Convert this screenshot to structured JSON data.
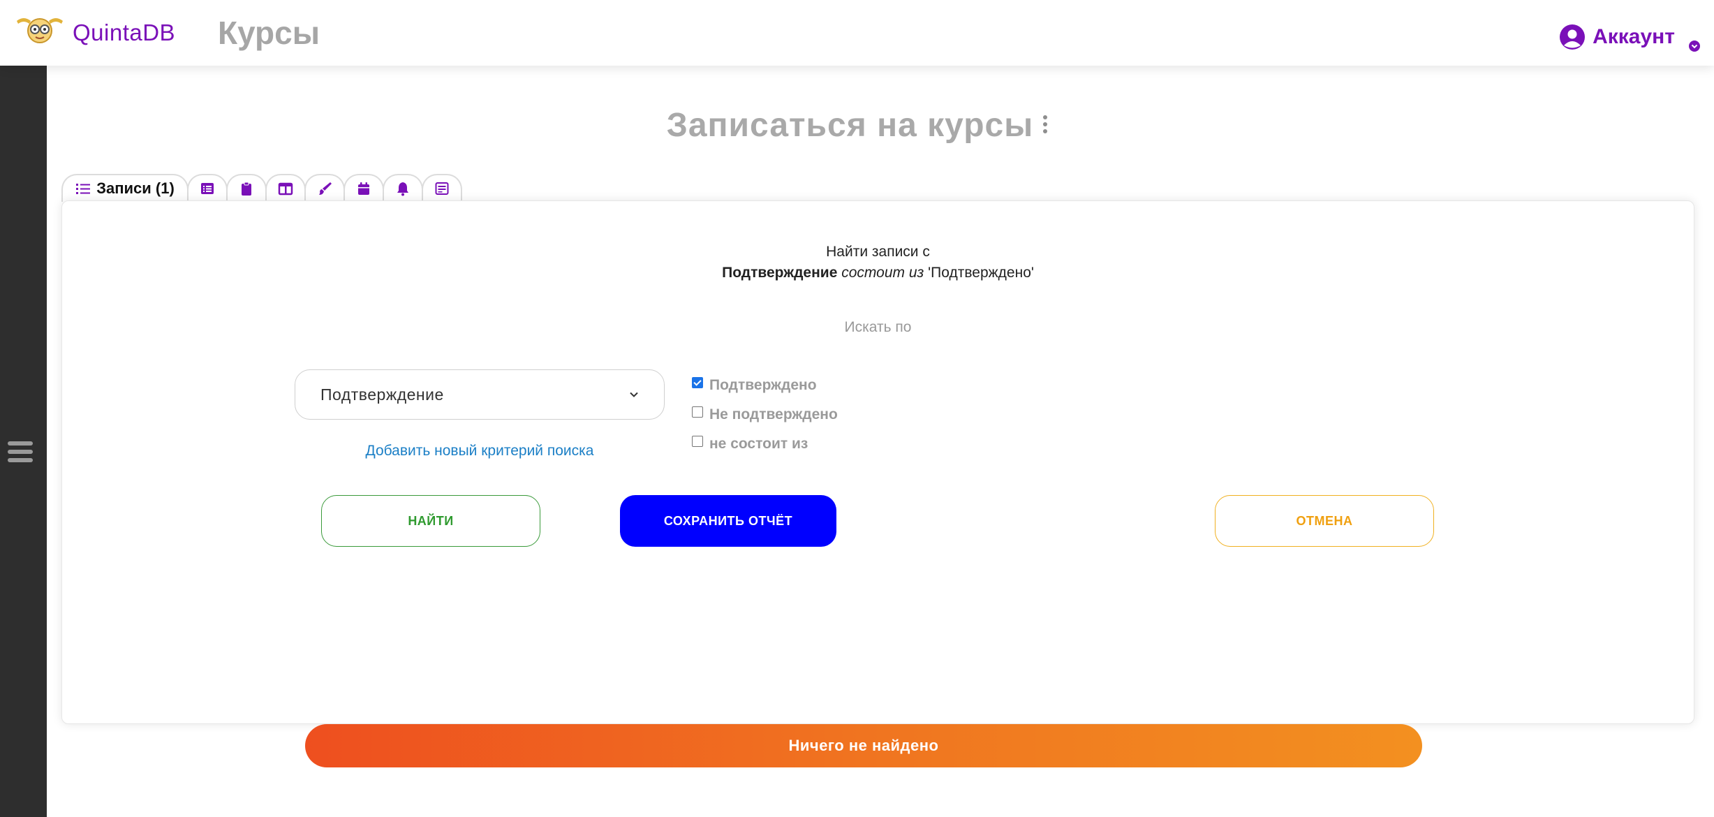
{
  "header": {
    "brand": "QuintaDB",
    "app_title": "Курсы",
    "account_label": "Аккаунт"
  },
  "page": {
    "heading": "Записаться на курсы"
  },
  "tabs": [
    {
      "label": "Записи (1)",
      "icon": "list-icon",
      "active": true
    },
    {
      "label": "",
      "icon": "table-list-icon"
    },
    {
      "label": "",
      "icon": "clipboard-icon"
    },
    {
      "label": "",
      "icon": "columns-icon"
    },
    {
      "label": "",
      "icon": "paintbrush-icon"
    },
    {
      "label": "",
      "icon": "calendar-icon"
    },
    {
      "label": "",
      "icon": "bell-icon"
    },
    {
      "label": "",
      "icon": "form-icon"
    }
  ],
  "search": {
    "intro": "Найти записи с",
    "field_name": "Подтверждение",
    "operator": "состоит из",
    "value": "'Подтверждено'",
    "search_by": "Искать по",
    "selected_field": "Подтверждение",
    "options": [
      {
        "label": "Подтверждено",
        "checked": true
      },
      {
        "label": "Не подтверждено",
        "checked": false
      },
      {
        "label": "не состоит из",
        "checked": false
      }
    ],
    "add_criterion": "Добавить новый критерий поиска"
  },
  "buttons": {
    "find": "НАЙТИ",
    "save_report": "СОХРАНИТЬ ОТЧЁТ",
    "cancel": "ОТМЕНА"
  },
  "result_banner": "Ничего не найдено",
  "colors": {
    "brand": "#7a10b8",
    "sidebar": "#2e2e2e",
    "save_button": "#0000ff",
    "find_button": "#2f9a2f",
    "cancel_button": "#f0a010",
    "banner_start": "#ee4f1f",
    "banner_end": "#f39020",
    "link": "#1b7fc6"
  }
}
